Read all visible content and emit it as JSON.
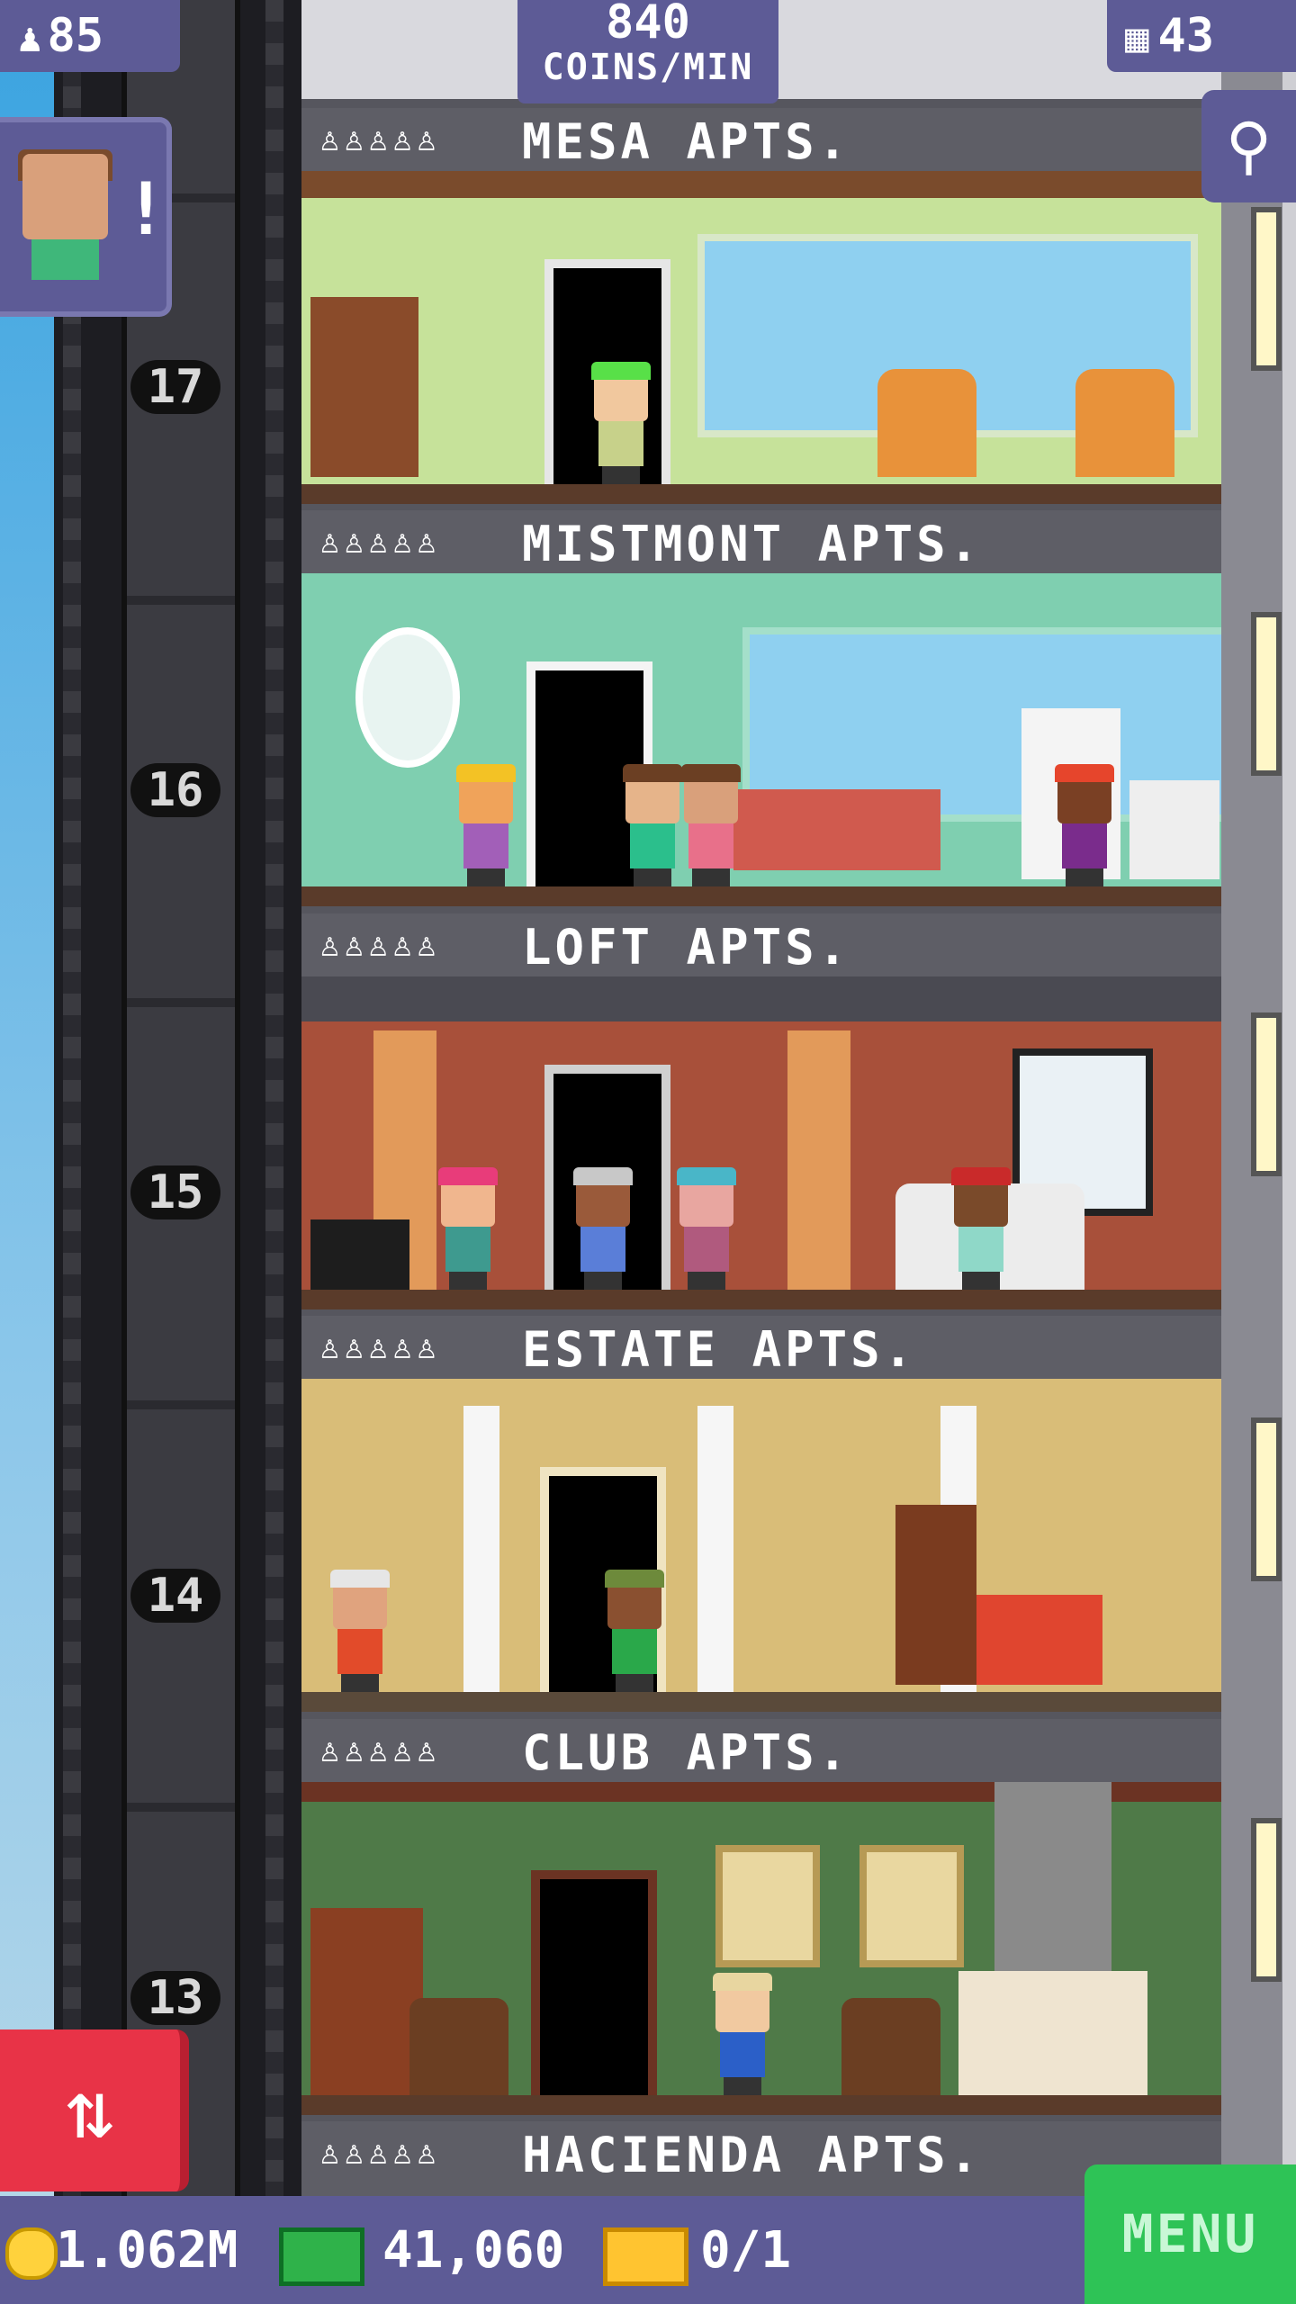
{
  "top": {
    "population": "85",
    "population_icon": "person-icon",
    "coins_per_min_value": "840",
    "coins_per_min_label": "COINS/MIN",
    "floors": "43",
    "floors_icon": "building-icon",
    "search_icon": "magnifier-icon"
  },
  "notification": {
    "icon": "!"
  },
  "floors": [
    {
      "number": "17",
      "name": "MESA APTS.",
      "residents": "♙♙♙♙♙"
    },
    {
      "number": "16",
      "name": "MISTMONT APTS.",
      "residents": "♙♙♙♙♙"
    },
    {
      "number": "15",
      "name": "LOFT APTS.",
      "residents": "♙♙♙♙♙"
    },
    {
      "number": "14",
      "name": "ESTATE APTS.",
      "residents": "♙♙♙♙♙"
    },
    {
      "number": "13",
      "name": "CLUB APTS.",
      "residents": "♙♙♙♙♙"
    },
    {
      "number": "",
      "name": "HACIENDA APTS.",
      "residents": "♙♙♙♙♙"
    }
  ],
  "bottom": {
    "coins": "1.062M",
    "tower_bux": "41,060",
    "tickets": "0/1"
  },
  "menu_label": "MENU",
  "elevator_icon": "⇅",
  "colors": {
    "bar": "#5d5b96",
    "menu": "#2ec356",
    "elevator_button": "#e83347"
  }
}
